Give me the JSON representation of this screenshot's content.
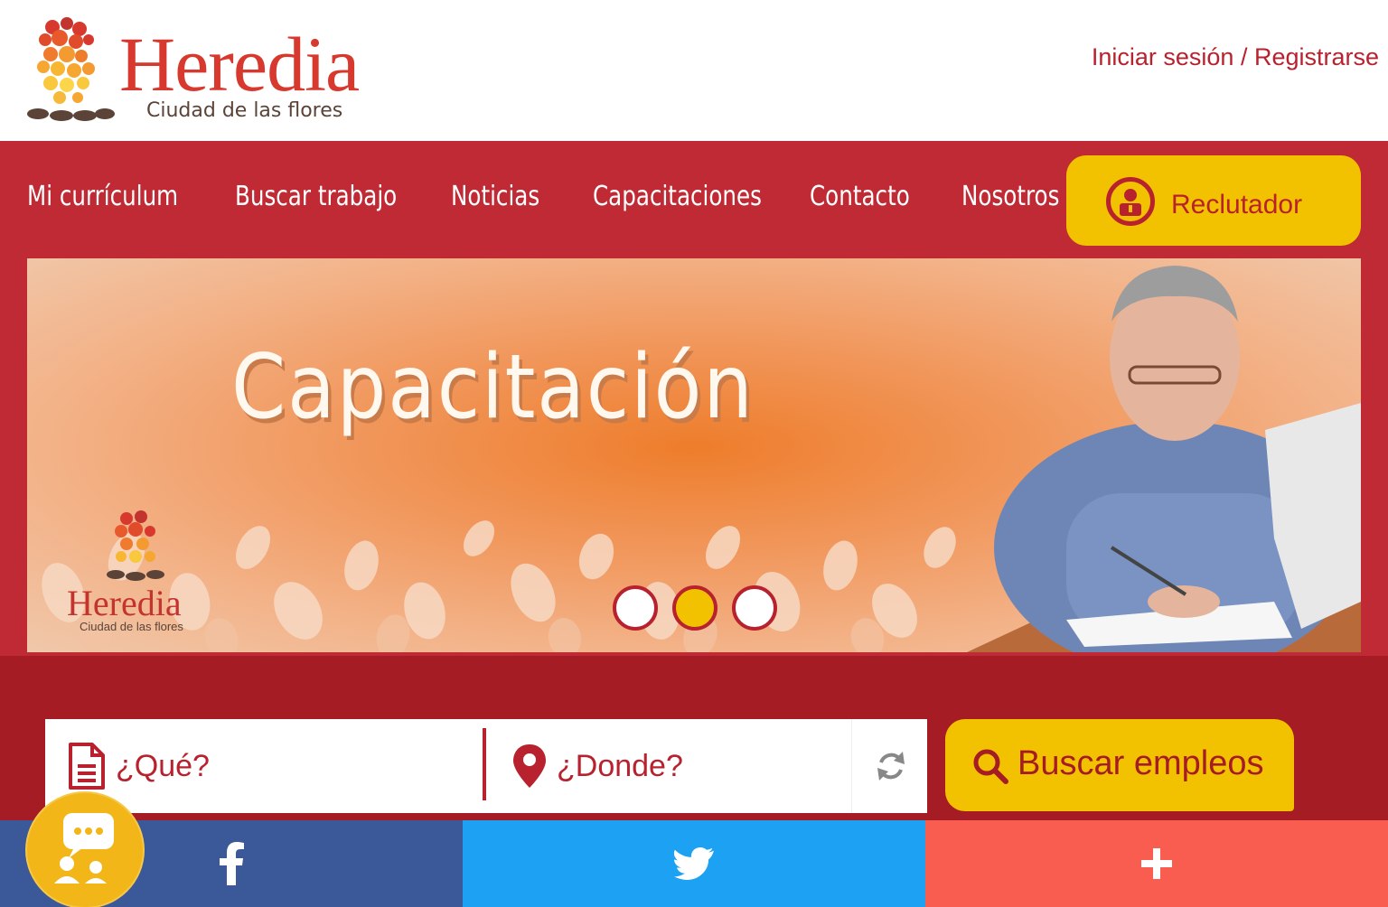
{
  "header": {
    "logo_title": "Heredia",
    "logo_subtitle": "Ciudad de las flores",
    "login_link": "Iniciar sesión / Registrarse"
  },
  "nav": {
    "items": [
      {
        "label": "Mi currículum"
      },
      {
        "label": "Buscar trabajo"
      },
      {
        "label": "Noticias"
      },
      {
        "label": "Capacitaciones"
      },
      {
        "label": "Contacto"
      },
      {
        "label": "Nosotros"
      }
    ],
    "recruiter_label": "Reclutador",
    "recruiter_icon": "recruiter-person-icon"
  },
  "banner": {
    "title": "Capacitación",
    "logo_title": "Heredia",
    "logo_subtitle": "Ciudad de las flores",
    "carousel": {
      "slides": 3,
      "active_index": 1
    }
  },
  "search": {
    "what_placeholder": "¿Qué?",
    "where_placeholder": "¿Donde?",
    "what_icon": "document-icon",
    "where_icon": "map-pin-icon",
    "reset_icon": "refresh-icon",
    "button_label": "Buscar empleos",
    "button_icon": "search-icon"
  },
  "social": {
    "facebook_icon": "facebook-icon",
    "twitter_icon": "twitter-icon",
    "more_icon": "plus-icon"
  },
  "colors": {
    "brand_red": "#c02a34",
    "dark_red": "#a51c25",
    "accent_yellow": "#f2c200",
    "facebook": "#3b5998",
    "twitter": "#1da1f2",
    "more": "#f95d4f"
  }
}
